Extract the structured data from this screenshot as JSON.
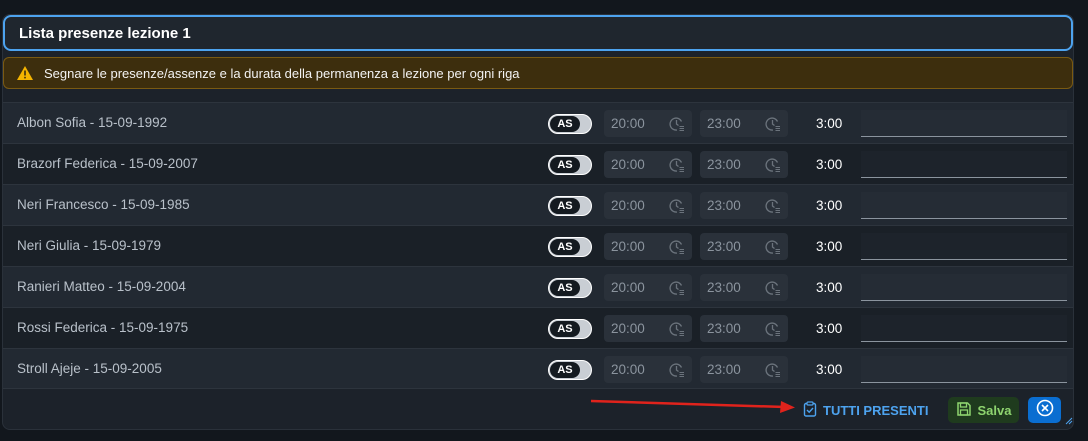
{
  "dialog": {
    "title": "Lista presenze lezione 1",
    "warning": "Segnare le presenze/assenze e la durata della permanenza a lezione per ogni riga"
  },
  "rows": [
    {
      "name": "Albon Sofia - 15-09-1992",
      "status": "AS",
      "start": "20:00",
      "end": "23:00",
      "duration": "3:00",
      "note": ""
    },
    {
      "name": "Brazorf Federica - 15-09-2007",
      "status": "AS",
      "start": "20:00",
      "end": "23:00",
      "duration": "3:00",
      "note": ""
    },
    {
      "name": "Neri Francesco - 15-09-1985",
      "status": "AS",
      "start": "20:00",
      "end": "23:00",
      "duration": "3:00",
      "note": ""
    },
    {
      "name": "Neri Giulia - 15-09-1979",
      "status": "AS",
      "start": "20:00",
      "end": "23:00",
      "duration": "3:00",
      "note": ""
    },
    {
      "name": "Ranieri Matteo - 15-09-2004",
      "status": "AS",
      "start": "20:00",
      "end": "23:00",
      "duration": "3:00",
      "note": ""
    },
    {
      "name": "Rossi Federica - 15-09-1975",
      "status": "AS",
      "start": "20:00",
      "end": "23:00",
      "duration": "3:00",
      "note": ""
    },
    {
      "name": "Stroll Ajeje - 15-09-2005",
      "status": "AS",
      "start": "20:00",
      "end": "23:00",
      "duration": "3:00",
      "note": ""
    }
  ],
  "footer": {
    "all_present_label": "TUTTI PRESENTI",
    "save_label": "Salva"
  },
  "icons": {
    "warning": "warning-triangle-icon",
    "time": "clock-list-icon",
    "all_present": "clipboard-check-icon",
    "save": "floppy-disk-icon",
    "close": "circle-x-icon",
    "annotation": "red-arrow"
  },
  "colors": {
    "accent": "#4da3ef",
    "warning_bg": "#3d2e0d",
    "save_text": "#8ed46f",
    "close_bg": "#0a6ed1",
    "arrow": "#e0231c"
  }
}
